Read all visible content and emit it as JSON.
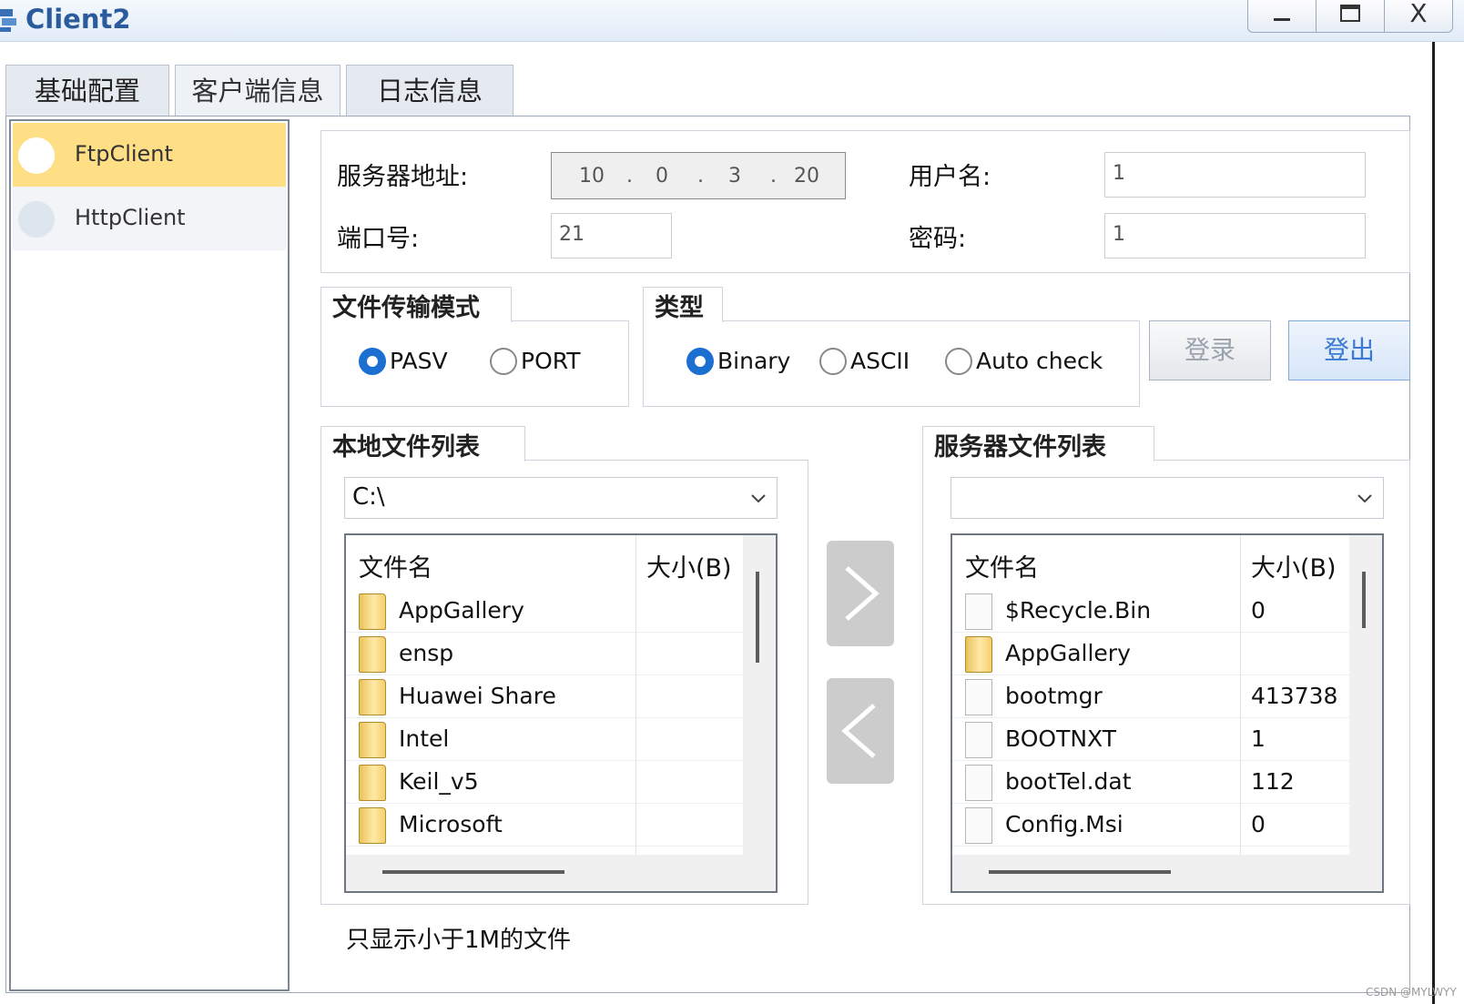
{
  "window": {
    "title": "Client2",
    "minimize": "_",
    "maximize": "▭",
    "close": "X"
  },
  "tabs": [
    {
      "label": "基础配置"
    },
    {
      "label": "客户端信息"
    },
    {
      "label": "日志信息"
    }
  ],
  "sidebar": {
    "items": [
      {
        "label": "FtpClient",
        "selected": true
      },
      {
        "label": "HttpClient",
        "selected": false
      }
    ]
  },
  "connection": {
    "server_label": "服务器地址:",
    "ip": [
      "10",
      "0",
      "3",
      "20"
    ],
    "port_label": "端口号:",
    "port_value": "21",
    "user_label": "用户名:",
    "user_value": "1",
    "password_label": "密码:",
    "password_value": "1"
  },
  "transfer_mode": {
    "title": "文件传输模式",
    "options": [
      {
        "label": "PASV",
        "selected": true
      },
      {
        "label": "PORT",
        "selected": false
      }
    ]
  },
  "type": {
    "title": "类型",
    "options": [
      {
        "label": "Binary",
        "selected": true
      },
      {
        "label": "ASCII",
        "selected": false
      },
      {
        "label": "Auto check",
        "selected": false
      }
    ]
  },
  "buttons": {
    "login": "登录",
    "logout": "登出"
  },
  "local": {
    "title": "本地文件列表",
    "path": "C:\\",
    "col_name": "文件名",
    "col_size": "大小(B)",
    "files": [
      {
        "name": "AppGallery",
        "size": "",
        "icon": "folder-icon"
      },
      {
        "name": "ensp",
        "size": "",
        "icon": "folder-icon"
      },
      {
        "name": "Huawei Share",
        "size": "",
        "icon": "folder-icon"
      },
      {
        "name": "Intel",
        "size": "",
        "icon": "folder-icon"
      },
      {
        "name": "Keil_v5",
        "size": "",
        "icon": "folder-icon"
      },
      {
        "name": "Microsoft",
        "size": "",
        "icon": "folder-icon"
      }
    ]
  },
  "server": {
    "title": "服务器文件列表",
    "path": "",
    "col_name": "文件名",
    "col_size": "大小(B)",
    "files": [
      {
        "name": "$Recycle.Bin",
        "size": "0",
        "icon": "file-icon"
      },
      {
        "name": "AppGallery",
        "size": "",
        "icon": "folder-icon"
      },
      {
        "name": "bootmgr",
        "size": "413738",
        "icon": "file-icon"
      },
      {
        "name": "BOOTNXT",
        "size": "1",
        "icon": "file-icon"
      },
      {
        "name": "bootTel.dat",
        "size": "112",
        "icon": "file-icon"
      },
      {
        "name": "Config.Msi",
        "size": "0",
        "icon": "file-icon"
      }
    ]
  },
  "transfer_buttons": {
    "upload": ">",
    "download": "<"
  },
  "footnote": "只显示小于1M的文件",
  "watermark": "CSDN @MYLWYY",
  "colors": {
    "accent": "#1a6fd1",
    "selected_item": "#ffdf85",
    "title": "#2a5b9c"
  }
}
